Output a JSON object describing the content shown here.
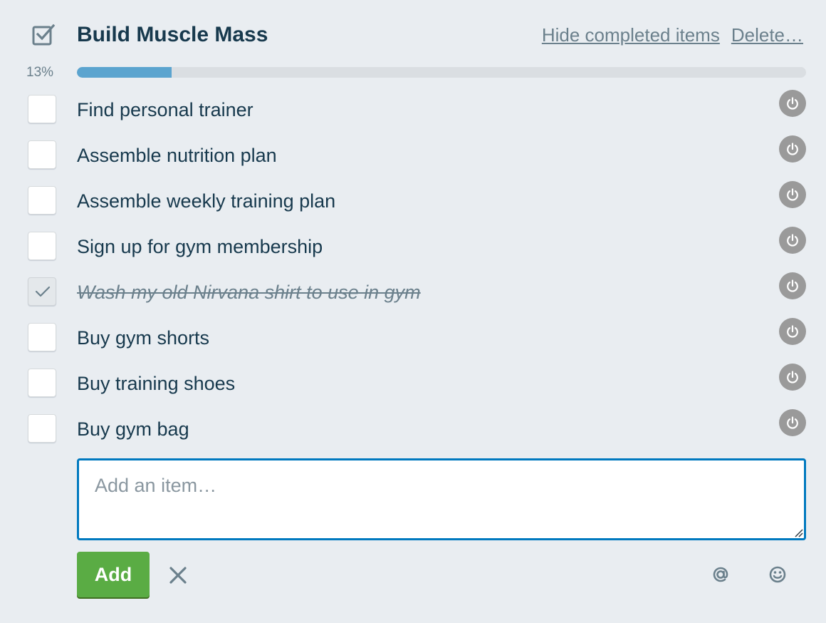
{
  "checklist": {
    "title": "Build Muscle Mass",
    "hide_completed_label": "Hide completed items",
    "delete_label": "Delete…",
    "progress_text": "13%",
    "progress_fraction": 0.13,
    "progress_color": "#5ba4cf",
    "items": [
      {
        "label": "Find personal trainer",
        "completed": false
      },
      {
        "label": "Assemble nutrition plan",
        "completed": false
      },
      {
        "label": "Assemble weekly training plan",
        "completed": false
      },
      {
        "label": "Sign up for gym membership",
        "completed": false
      },
      {
        "label": "Wash my old Nirvana shirt to use in gym",
        "completed": true
      },
      {
        "label": "Buy gym shorts",
        "completed": false
      },
      {
        "label": "Buy training shoes",
        "completed": false
      },
      {
        "label": "Buy gym bag",
        "completed": false
      }
    ],
    "item_action_icon": "power-icon"
  },
  "composer": {
    "placeholder": "Add an item…",
    "value": "",
    "add_label": "Add",
    "add_color": "#5aac44",
    "cancel_icon": "close-icon",
    "mention_icon": "at-icon",
    "emoji_icon": "smiley-icon"
  }
}
